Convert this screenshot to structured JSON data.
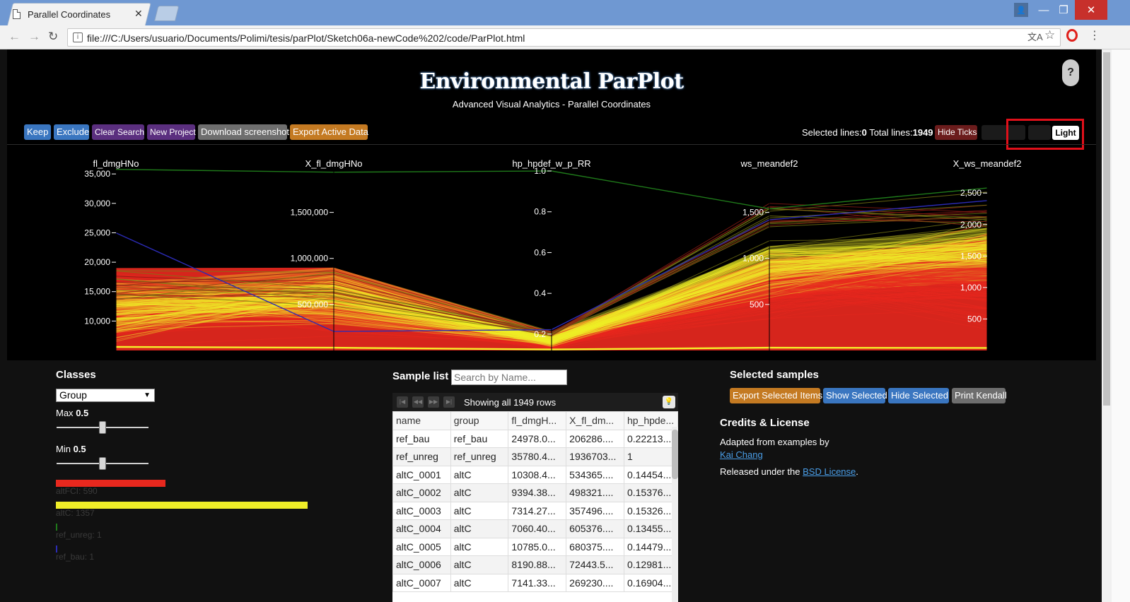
{
  "browser": {
    "tab_title": "Parallel Coordinates",
    "tab_close": "✕",
    "url": "file:///C:/Users/usuario/Documents/Polimi/tesis/parPlot/Sketch06a-newCode%202/code/ParPlot.html"
  },
  "app": {
    "title": "Environmental ParPlot",
    "subtitle": "Advanced Visual Analytics - Parallel Coordinates",
    "help": "?"
  },
  "toolbar": {
    "keep": "Keep",
    "exclude": "Exclude",
    "clear_search": "Clear Search",
    "new_project": "New Project",
    "download": "Download screenshot",
    "export_active": "Export Active Data",
    "selected_label": "Selected lines:",
    "selected_value": "0",
    "total_label": "Total lines:",
    "total_value": "1949",
    "hide_ticks": "Hide Ticks",
    "light": "Light"
  },
  "colors": {
    "red": "#e8281e",
    "yellow": "#f0ee28",
    "green": "#1f7a1a",
    "blue": "#2b2bb5",
    "blue_button": "#3a76c0",
    "purple_button": "#5b2f7f",
    "orange_button": "#c47a22"
  },
  "chart_data": {
    "type": "parallel-coordinates",
    "axes": [
      {
        "name": "fl_dmgHNo",
        "min": 5000,
        "max": 35500,
        "ticks": [
          10000,
          15000,
          20000,
          25000,
          30000,
          35000
        ],
        "tick_labels": [
          "10,000",
          "15,000",
          "20,000",
          "25,000",
          "30,000",
          "35,000"
        ]
      },
      {
        "name": "X_fl_dmgHNo",
        "min": 0,
        "max": 1950000,
        "ticks": [
          500000,
          1000000,
          1500000
        ],
        "tick_labels": [
          "500,000",
          "1,000,000",
          "1,500,000"
        ]
      },
      {
        "name": "hp_hpdef_w_p_RR",
        "min": 0.12,
        "max": 1.0,
        "ticks": [
          0.2,
          0.4,
          0.6,
          0.8,
          1.0
        ],
        "tick_labels": [
          "0.2",
          "0.4",
          "0.6",
          "0.8",
          "1.0"
        ]
      },
      {
        "name": "ws_meandef2",
        "min": 0,
        "max": 1950,
        "ticks": [
          500,
          1000,
          1500
        ],
        "tick_labels": [
          "500",
          "1,000",
          "1,500"
        ]
      },
      {
        "name": "X_ws_meandef2",
        "min": 0,
        "max": 2850,
        "ticks": [
          500,
          1000,
          1500,
          2000,
          2500
        ],
        "tick_labels": [
          "500",
          "1,000",
          "1,500",
          "2,000",
          "2,500"
        ]
      }
    ],
    "classes": [
      {
        "name": "altFCI",
        "count": 590,
        "color": "#e8281e"
      },
      {
        "name": "altC",
        "count": 1357,
        "color": "#f0ee28"
      },
      {
        "name": "ref_unreg",
        "count": 1,
        "color": "#1f7a1a"
      },
      {
        "name": "ref_bau",
        "count": 1,
        "color": "#2b2bb5"
      }
    ],
    "highlight_lines": [
      {
        "class": "ref_unreg",
        "values": [
          35780.4,
          1936703,
          1.0,
          1540,
          2580
        ]
      },
      {
        "class": "ref_bau",
        "values": [
          24978.0,
          206286,
          0.22213,
          1420,
          2380
        ]
      }
    ]
  },
  "classes_panel": {
    "title": "Classes",
    "group_select": "Group",
    "max_label": "Max",
    "max_value": "0.5",
    "min_label": "Min",
    "min_value": "0.5",
    "max_slider": 0.5,
    "min_slider": 0.5,
    "legend": [
      {
        "label": "altFCI: 590",
        "fraction": 0.435
      },
      {
        "label": "altC: 1357",
        "fraction": 1.0
      },
      {
        "label": "ref_unreg: 1",
        "fraction": 0.004
      },
      {
        "label": "ref_bau: 1",
        "fraction": 0.004
      }
    ]
  },
  "sample_list": {
    "title": "Sample list",
    "search_placeholder": "Search by Name...",
    "showing": "Showing all 1949 rows",
    "columns": [
      "name",
      "group",
      "fl_dmgH...",
      "X_fl_dm...",
      "hp_hpde..."
    ],
    "rows": [
      [
        "ref_bau",
        "ref_bau",
        "24978.0...",
        "206286....",
        "0.22213..."
      ],
      [
        "ref_unreg",
        "ref_unreg",
        "35780.4...",
        "1936703...",
        "1"
      ],
      [
        "altC_0001",
        "altC",
        "10308.4...",
        "534365....",
        "0.14454..."
      ],
      [
        "altC_0002",
        "altC",
        "9394.38...",
        "498321....",
        "0.15376..."
      ],
      [
        "altC_0003",
        "altC",
        "7314.27...",
        "357496....",
        "0.15326..."
      ],
      [
        "altC_0004",
        "altC",
        "7060.40...",
        "605376....",
        "0.13455..."
      ],
      [
        "altC_0005",
        "altC",
        "10785.0...",
        "680375....",
        "0.14479..."
      ],
      [
        "altC_0006",
        "altC",
        "8190.88...",
        "72443.5...",
        "0.12981..."
      ],
      [
        "altC_0007",
        "altC",
        "7141.33...",
        "269230....",
        "0.16904..."
      ]
    ]
  },
  "selected_samples": {
    "title": "Selected samples",
    "export_selected": "Export Selected Items",
    "show_selected": "Show Selected",
    "hide_selected": "Hide Selected",
    "print_kendall": "Print Kendall"
  },
  "credits": {
    "title": "Credits & License",
    "adapted": "Adapted from examples by",
    "author": "Kai Chang",
    "released_prefix": "Released under the",
    "license": "BSD License",
    "released_suffix": "."
  }
}
